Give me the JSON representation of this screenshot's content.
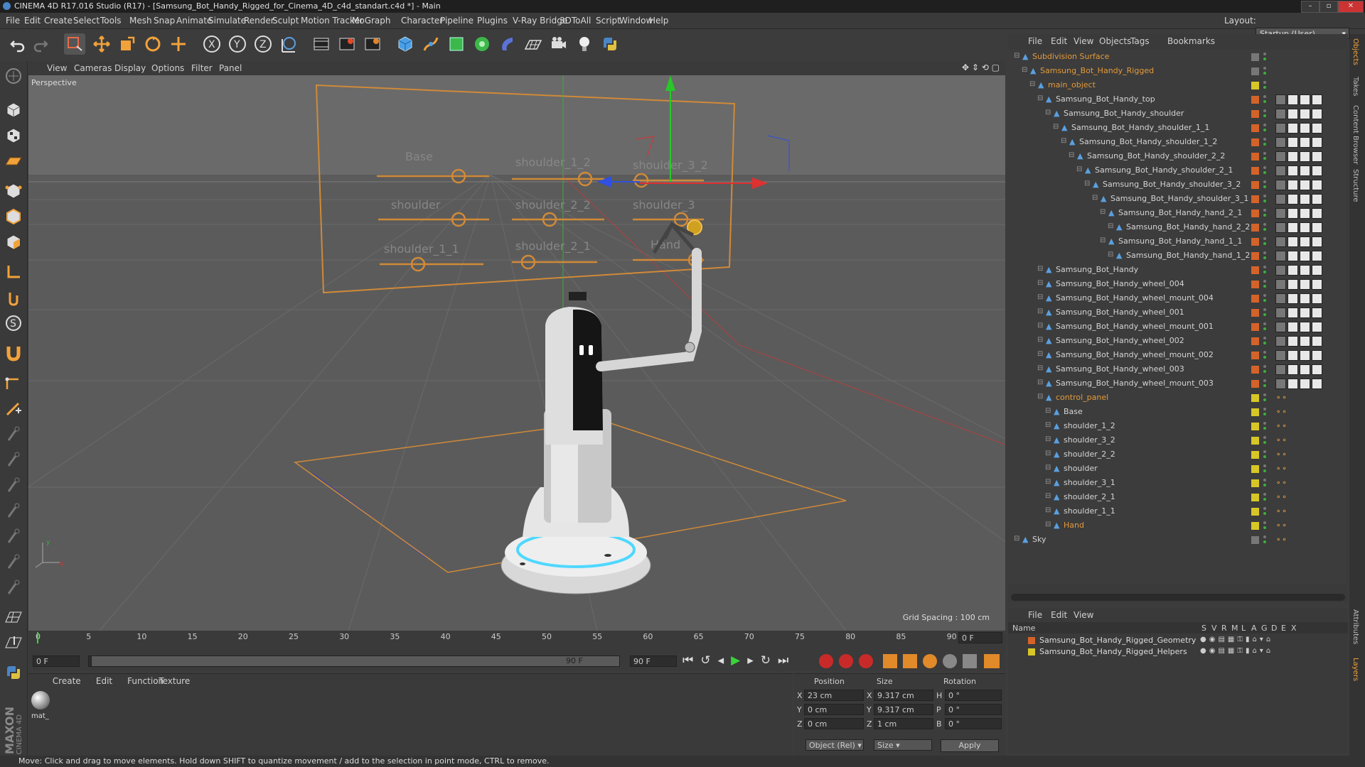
{
  "window": {
    "title": "CINEMA 4D R17.016 Studio (R17) - [Samsung_Bot_Handy_Rigged_for_Cinema_4D_c4d_standart.c4d *] - Main"
  },
  "menubar": {
    "items": [
      "File",
      "Edit",
      "Create",
      "Select",
      "Tools",
      "Mesh",
      "Snap",
      "Animate",
      "Simulate",
      "Render",
      "Sculpt",
      "Motion Tracker",
      "MoGraph",
      "Character",
      "Pipeline",
      "Plugins",
      "V-Ray Bridge",
      "3DToAll",
      "Script",
      "Window",
      "Help"
    ],
    "layout_label": "Layout:",
    "layout_value": "Startup (User)"
  },
  "toolbar": {
    "icons": [
      "undo-icon",
      "redo-icon",
      "live-selection-icon",
      "move-icon",
      "scale-icon",
      "rotate-icon",
      "transform-icon",
      "x-axis-icon",
      "y-axis-icon",
      "z-axis-icon",
      "world-coord-icon",
      "render-view-icon",
      "render-picture-icon",
      "render-settings-icon",
      "cube-icon",
      "pen-icon",
      "subdivision-icon",
      "cloner-icon",
      "deformer-icon",
      "floor-icon",
      "camera-icon",
      "light-icon",
      "python-icon"
    ]
  },
  "viewport": {
    "menu": [
      "View",
      "Cameras",
      "Display",
      "Options",
      "Filter",
      "Panel"
    ],
    "label": "Perspective",
    "grid_spacing": "Grid Spacing : 100 cm",
    "panel_labels": [
      "Base",
      "shoulder_1_2",
      "shoulder_3_2",
      "shoulder",
      "shoulder_2_2",
      "shoulder_3",
      "shoulder_1_1",
      "shoulder_2_1",
      "Hand"
    ]
  },
  "timeline": {
    "ticks": [
      "0",
      "5",
      "10",
      "15",
      "20",
      "25",
      "30",
      "35",
      "40",
      "45",
      "50",
      "55",
      "60",
      "65",
      "70",
      "75",
      "80",
      "85",
      "90"
    ],
    "frame_end": "0 F"
  },
  "transport": {
    "start": "0 F",
    "range_start": "0 F",
    "range_end": "90 F",
    "end": "90 F"
  },
  "material_manager": {
    "menu": [
      "Create",
      "Edit",
      "Function",
      "Texture"
    ],
    "material_name": "mat_"
  },
  "coordinates": {
    "headers": [
      "Position",
      "Size",
      "Rotation"
    ],
    "rows": [
      {
        "axis": "X",
        "pos": "23 cm",
        "saxis": "X",
        "size": "9.317 cm",
        "raxis": "H",
        "rot": "0 °"
      },
      {
        "axis": "Y",
        "pos": "0 cm",
        "saxis": "Y",
        "size": "9.317 cm",
        "raxis": "P",
        "rot": "0 °"
      },
      {
        "axis": "Z",
        "pos": "0 cm",
        "saxis": "Z",
        "size": "1 cm",
        "raxis": "B",
        "rot": "0 °"
      }
    ],
    "mode": "Object (Rel)",
    "size_mode": "Size",
    "apply": "Apply"
  },
  "object_manager": {
    "menu": [
      "File",
      "Edit",
      "View",
      "Objects",
      "Tags",
      "Bookmarks"
    ],
    "rows": [
      {
        "name": "Subdivision Surface",
        "indent": 0,
        "color": "orange",
        "tag": "#777"
      },
      {
        "name": "Samsung_Bot_Handy_Rigged",
        "indent": 1,
        "color": "orange",
        "tag": "#777"
      },
      {
        "name": "main_object",
        "indent": 2,
        "color": "orange",
        "tag": "#d7c726"
      },
      {
        "name": "Samsung_Bot_Handy_top",
        "indent": 3,
        "color": "white",
        "tag": "#d4632a"
      },
      {
        "name": "Samsung_Bot_Handy_shoulder",
        "indent": 4,
        "color": "white",
        "tag": "#d4632a"
      },
      {
        "name": "Samsung_Bot_Handy_shoulder_1_1",
        "indent": 5,
        "color": "white",
        "tag": "#d4632a"
      },
      {
        "name": "Samsung_Bot_Handy_shoulder_1_2",
        "indent": 6,
        "color": "white",
        "tag": "#d4632a"
      },
      {
        "name": "Samsung_Bot_Handy_shoulder_2_2",
        "indent": 7,
        "color": "white",
        "tag": "#d4632a"
      },
      {
        "name": "Samsung_Bot_Handy_shoulder_2_1",
        "indent": 8,
        "color": "white",
        "tag": "#d4632a"
      },
      {
        "name": "Samsung_Bot_Handy_shoulder_3_2",
        "indent": 9,
        "color": "white",
        "tag": "#d4632a"
      },
      {
        "name": "Samsung_Bot_Handy_shoulder_3_1",
        "indent": 10,
        "color": "white",
        "tag": "#d4632a"
      },
      {
        "name": "Samsung_Bot_Handy_hand_2_1",
        "indent": 11,
        "color": "white",
        "tag": "#d4632a"
      },
      {
        "name": "Samsung_Bot_Handy_hand_2_2",
        "indent": 12,
        "color": "white",
        "tag": "#d4632a"
      },
      {
        "name": "Samsung_Bot_Handy_hand_1_1",
        "indent": 11,
        "color": "white",
        "tag": "#d4632a"
      },
      {
        "name": "Samsung_Bot_Handy_hand_1_2",
        "indent": 12,
        "color": "white",
        "tag": "#d4632a"
      },
      {
        "name": "Samsung_Bot_Handy",
        "indent": 3,
        "color": "white",
        "tag": "#d4632a"
      },
      {
        "name": "Samsung_Bot_Handy_wheel_004",
        "indent": 3,
        "color": "white",
        "tag": "#d4632a"
      },
      {
        "name": "Samsung_Bot_Handy_wheel_mount_004",
        "indent": 3,
        "color": "white",
        "tag": "#d4632a"
      },
      {
        "name": "Samsung_Bot_Handy_wheel_001",
        "indent": 3,
        "color": "white",
        "tag": "#d4632a"
      },
      {
        "name": "Samsung_Bot_Handy_wheel_mount_001",
        "indent": 3,
        "color": "white",
        "tag": "#d4632a"
      },
      {
        "name": "Samsung_Bot_Handy_wheel_002",
        "indent": 3,
        "color": "white",
        "tag": "#d4632a"
      },
      {
        "name": "Samsung_Bot_Handy_wheel_mount_002",
        "indent": 3,
        "color": "white",
        "tag": "#d4632a"
      },
      {
        "name": "Samsung_Bot_Handy_wheel_003",
        "indent": 3,
        "color": "white",
        "tag": "#d4632a"
      },
      {
        "name": "Samsung_Bot_Handy_wheel_mount_003",
        "indent": 3,
        "color": "white",
        "tag": "#d4632a"
      },
      {
        "name": "control_panel",
        "indent": 3,
        "color": "orange",
        "tag": "#d7c726"
      },
      {
        "name": "Base",
        "indent": 4,
        "color": "white",
        "tag": "#d7c726"
      },
      {
        "name": "shoulder_1_2",
        "indent": 4,
        "color": "white",
        "tag": "#d7c726"
      },
      {
        "name": "shoulder_3_2",
        "indent": 4,
        "color": "white",
        "tag": "#d7c726"
      },
      {
        "name": "shoulder_2_2",
        "indent": 4,
        "color": "white",
        "tag": "#d7c726"
      },
      {
        "name": "shoulder",
        "indent": 4,
        "color": "white",
        "tag": "#d7c726"
      },
      {
        "name": "shoulder_3_1",
        "indent": 4,
        "color": "white",
        "tag": "#d7c726"
      },
      {
        "name": "shoulder_2_1",
        "indent": 4,
        "color": "white",
        "tag": "#d7c726"
      },
      {
        "name": "shoulder_1_1",
        "indent": 4,
        "color": "white",
        "tag": "#d7c726"
      },
      {
        "name": "Hand",
        "indent": 4,
        "color": "orange",
        "tag": "#d7c726"
      },
      {
        "name": "Sky",
        "indent": 0,
        "color": "white",
        "tag": "#777"
      }
    ]
  },
  "layer_manager": {
    "menu": [
      "File",
      "Edit",
      "View"
    ],
    "columns": [
      "Name",
      "S",
      "V",
      "R",
      "M",
      "L",
      "A",
      "G",
      "D",
      "E",
      "X"
    ],
    "layers": [
      {
        "name": "Samsung_Bot_Handy_Rigged_Geometry",
        "color": "#d4632a"
      },
      {
        "name": "Samsung_Bot_Handy_Rigged_Helpers",
        "color": "#d7c726"
      }
    ]
  },
  "right_tabs": [
    "Objects",
    "Takes",
    "Content Browser",
    "Structure",
    "Attributes",
    "Layers"
  ],
  "brand": {
    "line1": "MAXON",
    "line2": "CINEMA 4D"
  },
  "status": "Move: Click and drag to move elements. Hold down SHIFT to quantize movement / add to the selection in point mode, CTRL to remove."
}
